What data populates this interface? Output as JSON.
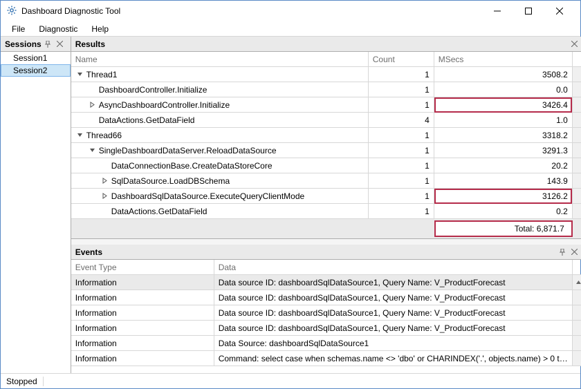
{
  "title": "Dashboard Diagnostic Tool",
  "menu": {
    "file": "File",
    "diagnostic": "Diagnostic",
    "help": "Help"
  },
  "sessions": {
    "title": "Sessions",
    "items": [
      "Session1",
      "Session2"
    ],
    "selected": 1
  },
  "results": {
    "title": "Results",
    "columns": {
      "name": "Name",
      "count": "Count",
      "msecs": "MSecs"
    },
    "total_label": "Total: 6,871.7",
    "rows": [
      {
        "indent": 0,
        "expander": "open",
        "name": "Thread1",
        "count": "1",
        "msecs": "3508.2",
        "highlight": false
      },
      {
        "indent": 1,
        "expander": "none",
        "name": "DashboardController.Initialize",
        "count": "1",
        "msecs": "0.0",
        "highlight": false
      },
      {
        "indent": 1,
        "expander": "closed",
        "name": "AsyncDashboardController.Initialize",
        "count": "1",
        "msecs": "3426.4",
        "highlight": true
      },
      {
        "indent": 1,
        "expander": "none",
        "name": "DataActions.GetDataField",
        "count": "4",
        "msecs": "1.0",
        "highlight": false
      },
      {
        "indent": 0,
        "expander": "open",
        "name": "Thread66",
        "count": "1",
        "msecs": "3318.2",
        "highlight": false
      },
      {
        "indent": 1,
        "expander": "open",
        "name": "SingleDashboardDataServer.ReloadDataSource",
        "count": "1",
        "msecs": "3291.3",
        "highlight": false
      },
      {
        "indent": 2,
        "expander": "none",
        "name": "DataConnectionBase.CreateDataStoreCore",
        "count": "1",
        "msecs": "20.2",
        "highlight": false
      },
      {
        "indent": 2,
        "expander": "closed",
        "name": "SqlDataSource.LoadDBSchema",
        "count": "1",
        "msecs": "143.9",
        "highlight": false
      },
      {
        "indent": 2,
        "expander": "closed",
        "name": "DashboardSqlDataSource.ExecuteQueryClientMode",
        "count": "1",
        "msecs": "3126.2",
        "highlight": true
      },
      {
        "indent": 2,
        "expander": "none",
        "name": "DataActions.GetDataField",
        "count": "1",
        "msecs": "0.2",
        "highlight": false
      }
    ]
  },
  "events": {
    "title": "Events",
    "columns": {
      "type": "Event Type",
      "data": "Data"
    },
    "rows": [
      {
        "type": "Information",
        "data": "Data source ID: dashboardSqlDataSource1, Query Name: V_ProductForecast",
        "selected": true
      },
      {
        "type": "Information",
        "data": "Data source ID: dashboardSqlDataSource1, Query Name: V_ProductForecast",
        "selected": false
      },
      {
        "type": "Information",
        "data": "Data source ID: dashboardSqlDataSource1, Query Name: V_ProductForecast",
        "selected": false
      },
      {
        "type": "Information",
        "data": "Data source ID: dashboardSqlDataSource1, Query Name: V_ProductForecast",
        "selected": false
      },
      {
        "type": "Information",
        "data": "Data Source: dashboardSqlDataSource1",
        "selected": false
      },
      {
        "type": "Information",
        "data": "Command: select case when schemas.name <> 'dbo' or CHARINDEX('.', objects.name) > 0 t…",
        "selected": false
      }
    ]
  },
  "status": "Stopped"
}
